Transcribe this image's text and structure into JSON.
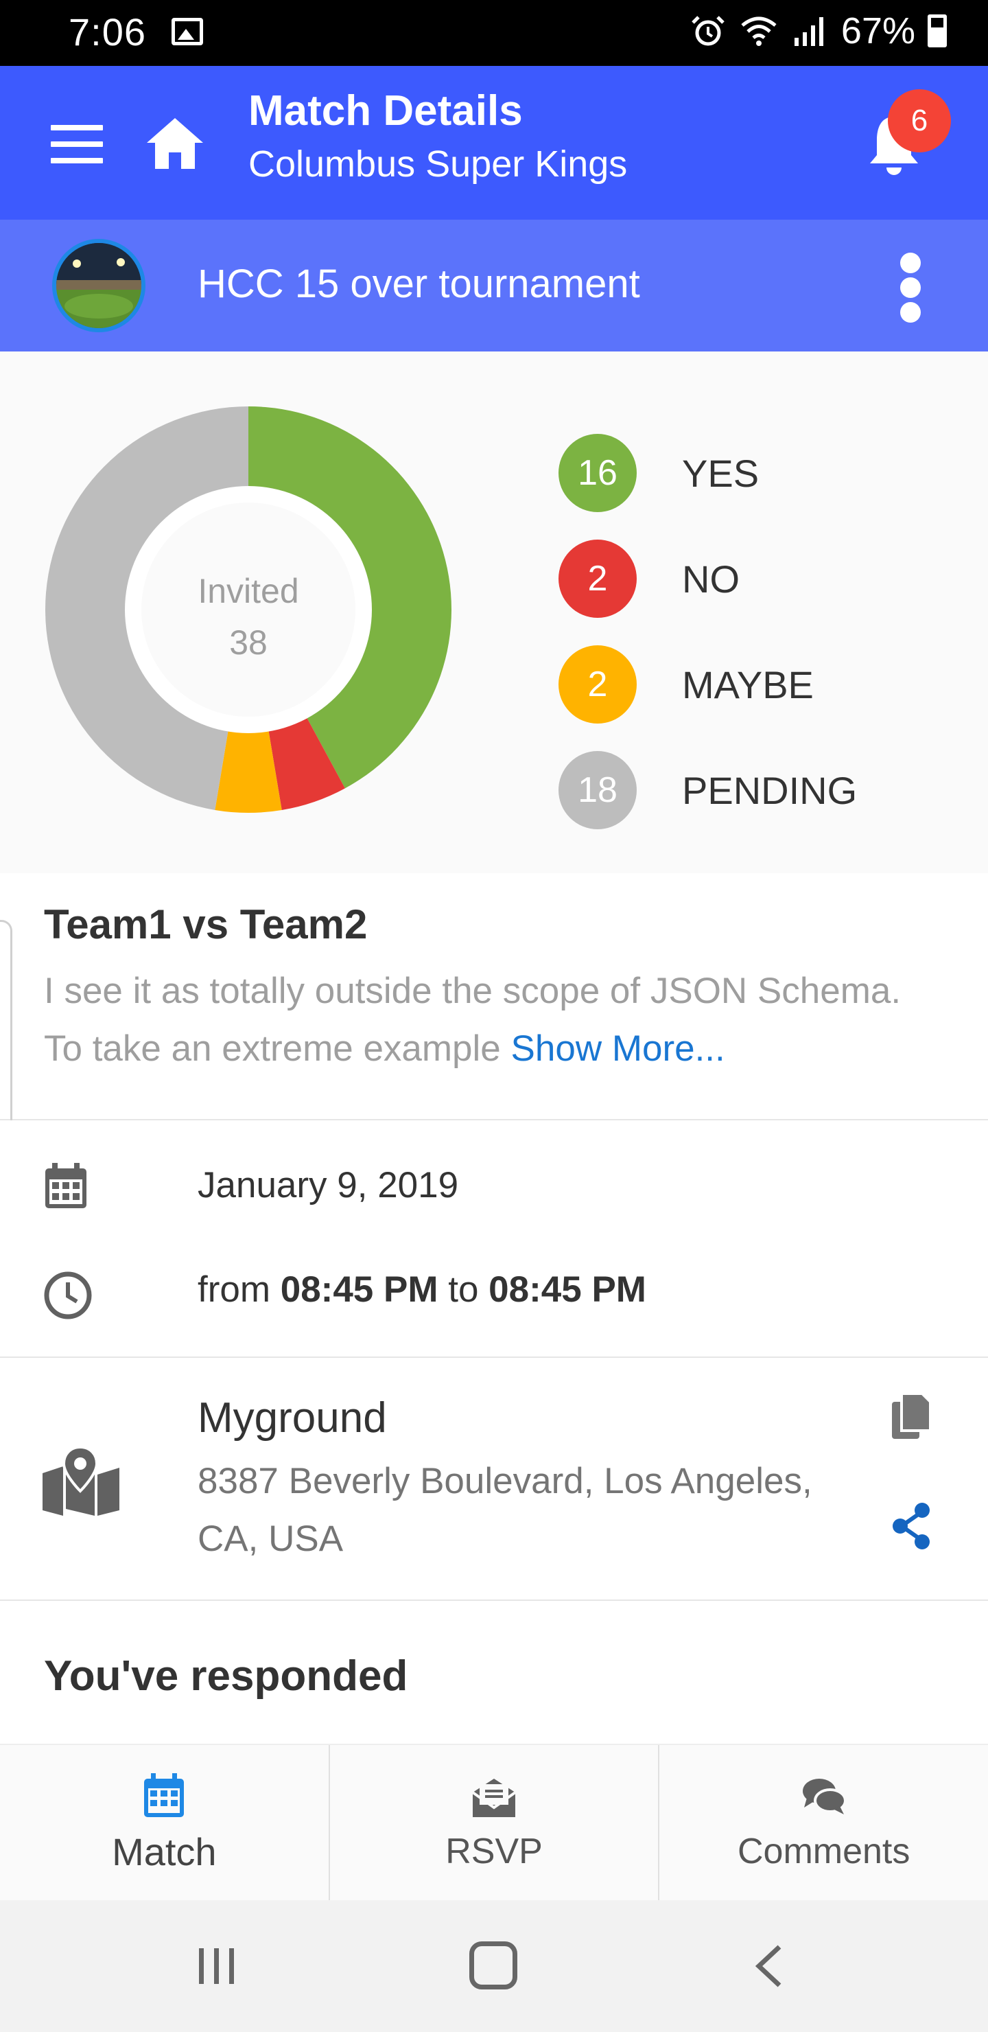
{
  "status_bar": {
    "time": "7:06",
    "battery": "67%"
  },
  "app_bar": {
    "title": "Match Details",
    "subtitle": "Columbus Super Kings",
    "notification_count": "6"
  },
  "group": {
    "title": "HCC 15 over tournament"
  },
  "rsvp_chart": {
    "center_label": "Invited",
    "center_value": "38",
    "legend": [
      {
        "count": "16",
        "label": "YES",
        "color": "#7cb342"
      },
      {
        "count": "2",
        "label": "NO",
        "color": "#e53935"
      },
      {
        "count": "2",
        "label": "MAYBE",
        "color": "#ffb300"
      },
      {
        "count": "18",
        "label": "PENDING",
        "color": "#bdbdbd"
      }
    ]
  },
  "chart_data": {
    "type": "pie",
    "categories": [
      "YES",
      "NO",
      "MAYBE",
      "PENDING"
    ],
    "values": [
      16,
      2,
      2,
      18
    ],
    "colors": [
      "#7cb342",
      "#e53935",
      "#ffb300",
      "#bdbdbd"
    ],
    "title": ""
  },
  "match": {
    "title": "Team1 vs Team2",
    "description": "I see it as totally outside the scope of JSON Schema. To take an extreme example ",
    "show_more": "Show More..."
  },
  "datetime": {
    "date": "January 9, 2019",
    "from_word": "from ",
    "start": "08:45 PM",
    "to_word": " to ",
    "end": "08:45 PM"
  },
  "location": {
    "name": "Myground",
    "address": "8387 Beverly Boulevard, Los Angeles, CA, USA"
  },
  "response": {
    "title": "You've responded"
  },
  "bottom_nav": {
    "items": [
      {
        "label": "Match",
        "icon": "calendar-icon"
      },
      {
        "label": "RSVP",
        "icon": "rsvp-envelope-icon"
      },
      {
        "label": "Comments",
        "icon": "comments-icon"
      }
    ],
    "accent": "#1e88e5"
  },
  "colors": {
    "primary": "#3d5afe",
    "secondary": "#5b73fb",
    "link": "#1976d2"
  }
}
